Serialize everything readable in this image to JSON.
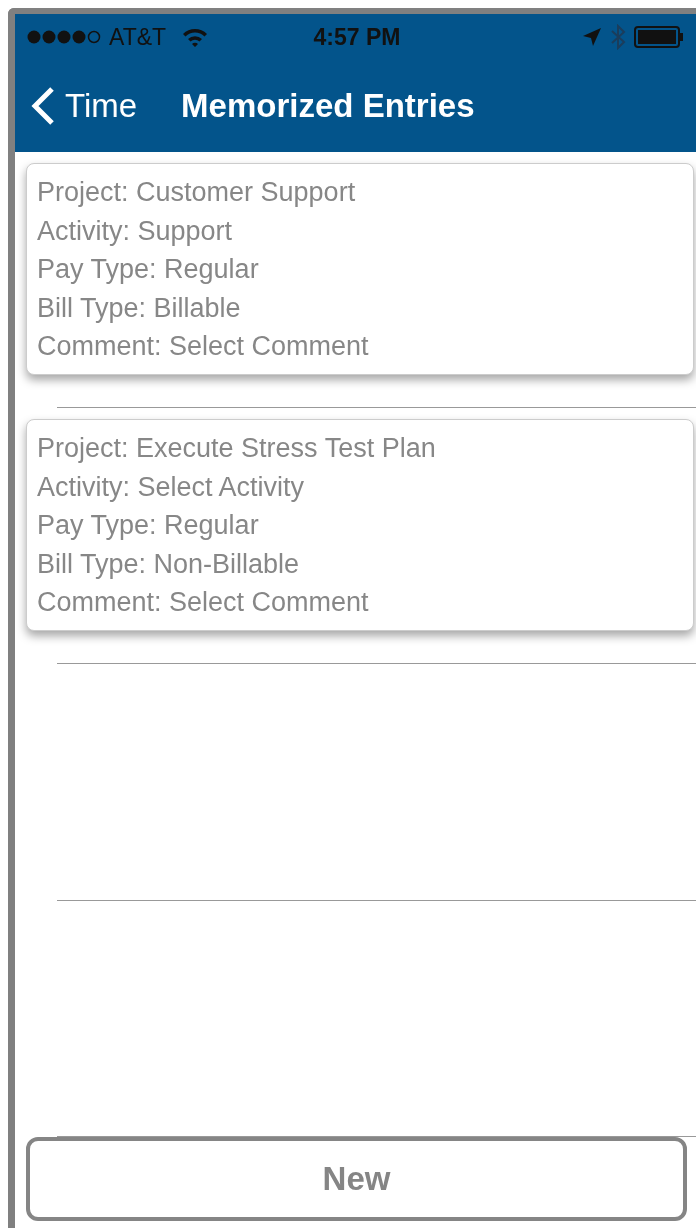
{
  "status_bar": {
    "carrier": "AT&T",
    "time": "4:57 PM"
  },
  "nav": {
    "back_label": "Time",
    "title": "Memorized Entries"
  },
  "entries": [
    {
      "lines": [
        "Project: Customer Support",
        "Activity: Support",
        "Pay Type: Regular",
        "Bill Type: Billable",
        "Comment: Select Comment"
      ]
    },
    {
      "lines": [
        "Project: Execute Stress Test Plan",
        "Activity: Select Activity",
        "Pay Type: Regular",
        "Bill Type: Non-Billable",
        "Comment: Select Comment"
      ]
    }
  ],
  "button": {
    "label": "New"
  }
}
